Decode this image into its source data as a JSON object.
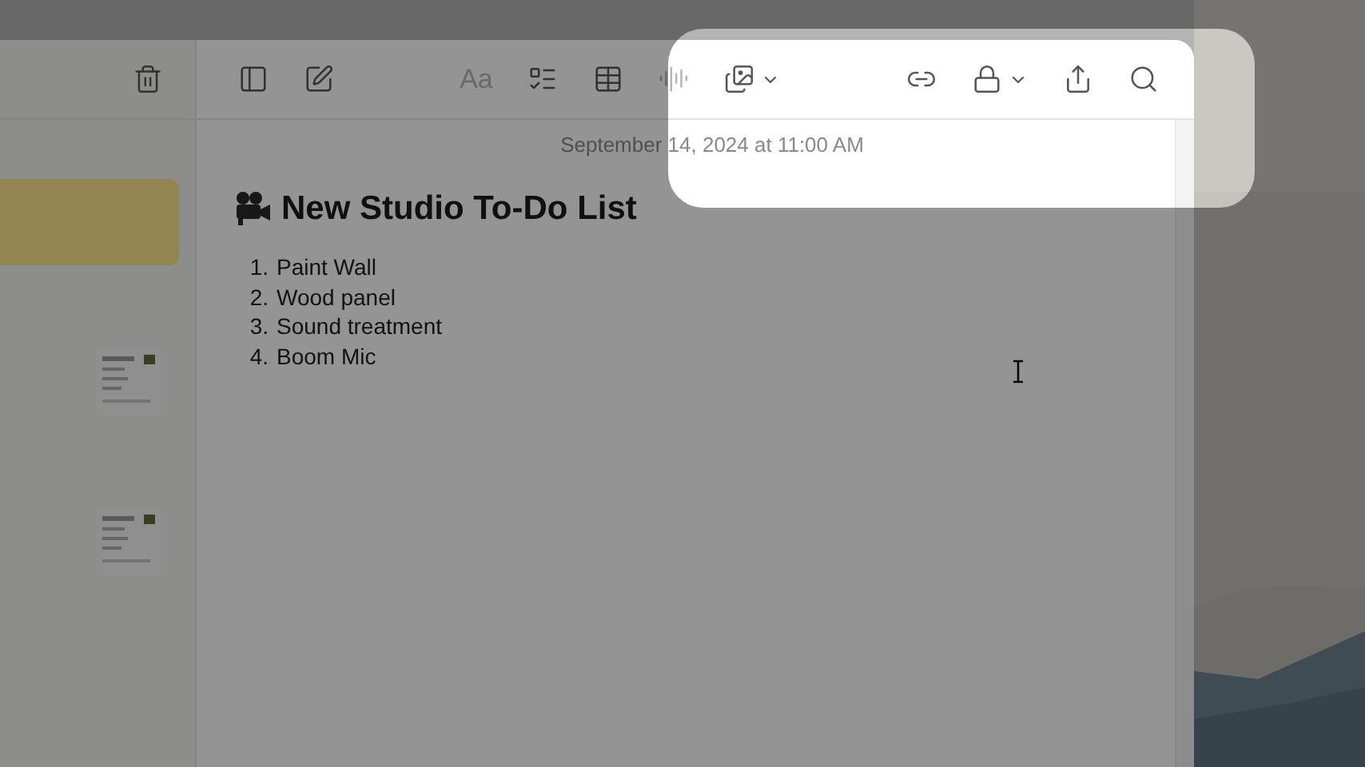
{
  "note_list": [
    {
      "selected": true,
      "kind": "plain"
    },
    {
      "selected": false,
      "kind": "thumbnail"
    },
    {
      "selected": false,
      "kind": "thumbnail"
    }
  ],
  "toolbar": [
    {
      "kind": "sidebar",
      "disabled": false
    },
    {
      "kind": "compose",
      "disabled": false
    },
    {
      "kind": "format",
      "label": "Aa",
      "disabled": true
    },
    {
      "kind": "checklist",
      "disabled": false
    },
    {
      "kind": "table",
      "disabled": false
    },
    {
      "kind": "audio",
      "disabled": true
    },
    {
      "kind": "media",
      "disabled": false
    },
    {
      "kind": "collaborate",
      "disabled": false
    },
    {
      "kind": "lock",
      "disabled": false
    },
    {
      "kind": "share",
      "disabled": false
    },
    {
      "kind": "search",
      "disabled": false
    }
  ],
  "note": {
    "date": "September 14, 2024 at 11:00 AM",
    "title": "New Studio To-Do List",
    "items": [
      {
        "number": "1.",
        "text": "Paint Wall"
      },
      {
        "number": "2.",
        "text": "Wood panel"
      },
      {
        "number": "3.",
        "text": "Sound treatment"
      },
      {
        "number": "4.",
        "text": "Boom Mic"
      }
    ]
  }
}
